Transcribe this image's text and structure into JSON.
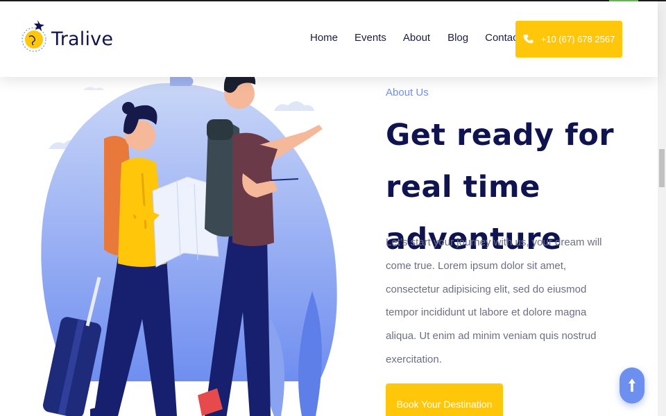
{
  "brand": {
    "name": "Tralive"
  },
  "nav": {
    "items": [
      {
        "label": "Home"
      },
      {
        "label": "Events"
      },
      {
        "label": "About"
      },
      {
        "label": "Blog"
      },
      {
        "label": "Contact"
      }
    ]
  },
  "header": {
    "phone_label": "+10 (67) 678 2567"
  },
  "about": {
    "eyebrow": "About Us",
    "headline": "Get ready for real time adventure",
    "body": "Let’s start your journey with us, your dream will come true. Lorem ipsum dolor sit amet, consectetur adipisicing elit, sed do eiusmod tempor incididunt ut labore et dolore magna aliqua. Ut enim ad minim veniam quis nostrud exercitation.",
    "cta_label": "Book Your Destination"
  },
  "icons": {
    "phone": "phone-icon",
    "back_to_top": "arrow-up-icon",
    "logo": "globe-plane-icon"
  },
  "colors": {
    "accent": "#ffc60a",
    "navy": "#0f1450",
    "blue": "#6d8ff0",
    "text": "#6c6f84"
  }
}
